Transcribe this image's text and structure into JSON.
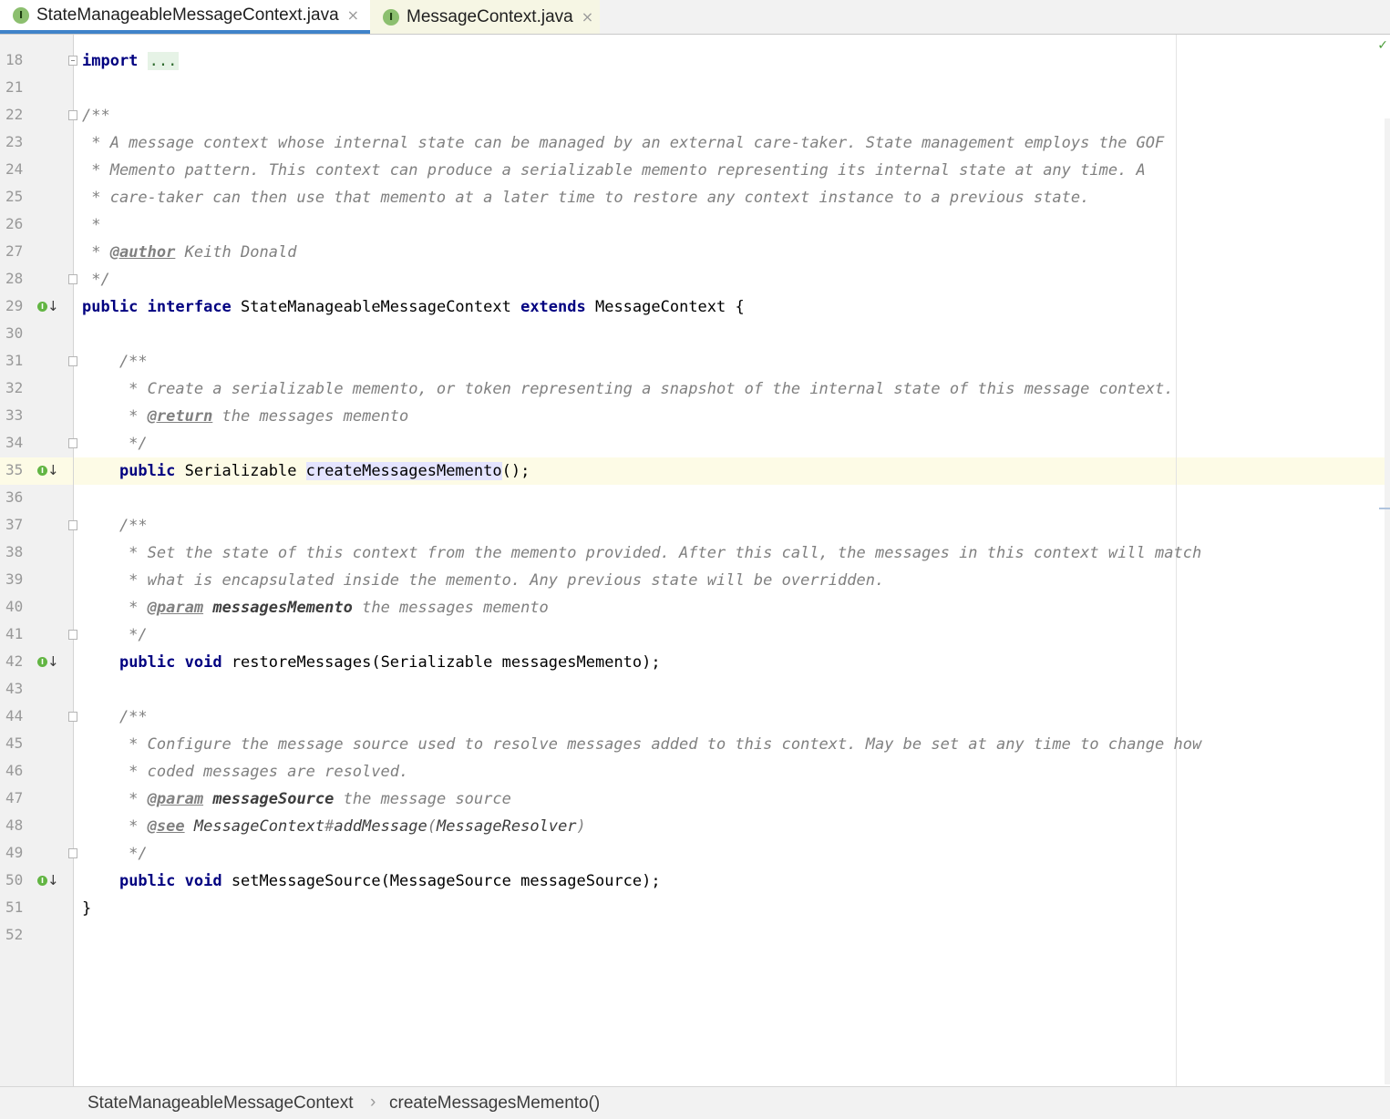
{
  "tabs": [
    {
      "label": "StateManageableMessageContext.java",
      "icon": "I",
      "close": "×",
      "active": true
    },
    {
      "label": "MessageContext.java",
      "icon": "I",
      "close": "×",
      "active": false
    }
  ],
  "lines": [
    {
      "n": "18",
      "code": "import ...",
      "fold": "plus"
    },
    {
      "n": "21",
      "code": ""
    },
    {
      "n": "22",
      "code": "/**",
      "fold": "open"
    },
    {
      "n": "23",
      "code": " * A message context whose internal state can be managed by an external care-taker. State management employs the GOF"
    },
    {
      "n": "24",
      "code": " * Memento pattern. This context can produce a serializable memento representing its internal state at any time. A"
    },
    {
      "n": "25",
      "code": " * care-taker can then use that memento at a later time to restore any context instance to a previous state."
    },
    {
      "n": "26",
      "code": " *"
    },
    {
      "n": "27",
      "code": " * @author Keith Donald"
    },
    {
      "n": "28",
      "code": " */",
      "fold": "close"
    },
    {
      "n": "29",
      "code": "public interface StateManageableMessageContext extends MessageContext {",
      "icon": true
    },
    {
      "n": "30",
      "code": ""
    },
    {
      "n": "31",
      "code": "    /**",
      "fold": "open"
    },
    {
      "n": "32",
      "code": "     * Create a serializable memento, or token representing a snapshot of the internal state of this message context."
    },
    {
      "n": "33",
      "code": "     * @return the messages memento"
    },
    {
      "n": "34",
      "code": "     */",
      "fold": "close"
    },
    {
      "n": "35",
      "code": "    public Serializable createMessagesMemento();",
      "icon": true,
      "current": true
    },
    {
      "n": "36",
      "code": ""
    },
    {
      "n": "37",
      "code": "    /**",
      "fold": "open"
    },
    {
      "n": "38",
      "code": "     * Set the state of this context from the memento provided. After this call, the messages in this context will match"
    },
    {
      "n": "39",
      "code": "     * what is encapsulated inside the memento. Any previous state will be overridden."
    },
    {
      "n": "40",
      "code": "     * @param messagesMemento the messages memento"
    },
    {
      "n": "41",
      "code": "     */",
      "fold": "close"
    },
    {
      "n": "42",
      "code": "    public void restoreMessages(Serializable messagesMemento);",
      "icon": true
    },
    {
      "n": "43",
      "code": ""
    },
    {
      "n": "44",
      "code": "    /**",
      "fold": "open"
    },
    {
      "n": "45",
      "code": "     * Configure the message source used to resolve messages added to this context. May be set at any time to change how"
    },
    {
      "n": "46",
      "code": "     * coded messages are resolved."
    },
    {
      "n": "47",
      "code": "     * @param messageSource the message source"
    },
    {
      "n": "48",
      "code": "     * @see MessageContext#addMessage(MessageResolver)"
    },
    {
      "n": "49",
      "code": "     */",
      "fold": "close"
    },
    {
      "n": "50",
      "code": "    public void setMessageSource(MessageSource messageSource);",
      "icon": true
    },
    {
      "n": "51",
      "code": "}"
    },
    {
      "n": "52",
      "code": ""
    }
  ],
  "breadcrumb": {
    "items": [
      "StateManageableMessageContext",
      "createMessagesMemento()"
    ],
    "separator": "›"
  },
  "colors": {
    "keyword": "#000080",
    "comment": "#808080",
    "current_line": "#fdfbe6",
    "active_tab_underline": "#4083c9",
    "interface_icon": "#8cbf6f"
  }
}
